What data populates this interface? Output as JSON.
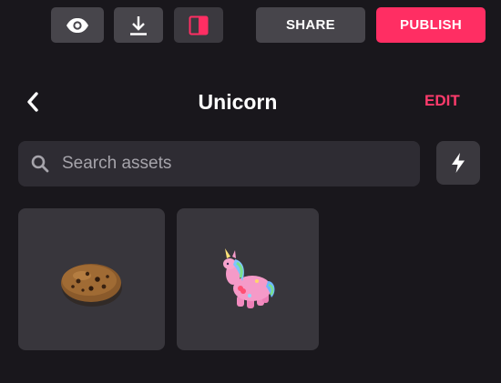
{
  "toolbar": {
    "share_label": "SHARE",
    "publish_label": "PUBLISH",
    "icons": {
      "preview": "eye-icon",
      "download": "download-icon",
      "split": "split-view-icon"
    },
    "publish_color": "#ff2e63"
  },
  "header": {
    "title": "Unicorn",
    "edit_label": "EDIT",
    "back_icon": "chevron-left-icon"
  },
  "search": {
    "placeholder": "Search assets",
    "value": "",
    "icon": "search-icon",
    "action_icon": "lightning-bolt-icon"
  },
  "assets": [
    {
      "name": "cookie",
      "thumbnail": "cookie"
    },
    {
      "name": "unicorn",
      "thumbnail": "unicorn"
    }
  ],
  "colors": {
    "background": "#19171c",
    "accent": "#ff3b6c",
    "tile": "#38363c"
  }
}
